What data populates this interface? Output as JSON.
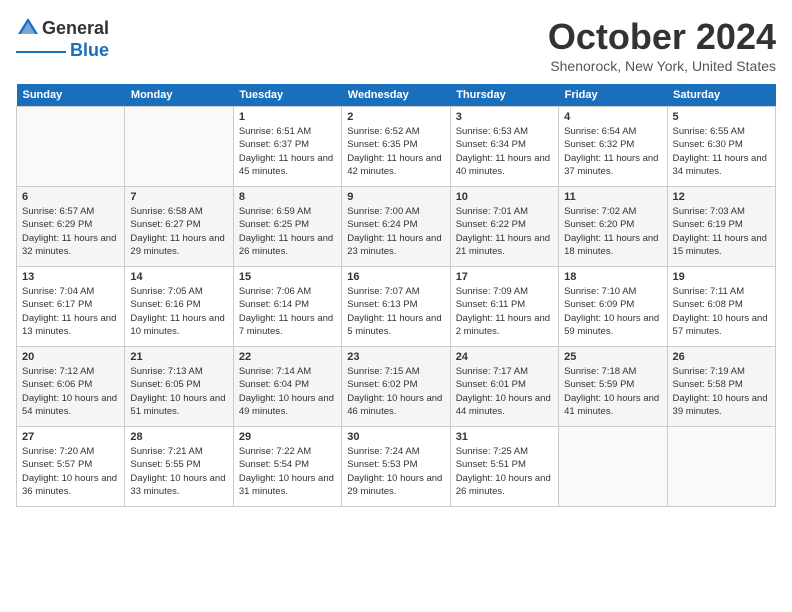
{
  "header": {
    "logo_general": "General",
    "logo_blue": "Blue",
    "month": "October 2024",
    "location": "Shenorock, New York, United States"
  },
  "days_of_week": [
    "Sunday",
    "Monday",
    "Tuesday",
    "Wednesday",
    "Thursday",
    "Friday",
    "Saturday"
  ],
  "weeks": [
    [
      {
        "day": "",
        "info": ""
      },
      {
        "day": "",
        "info": ""
      },
      {
        "day": "1",
        "info": "Sunrise: 6:51 AM\nSunset: 6:37 PM\nDaylight: 11 hours and 45 minutes."
      },
      {
        "day": "2",
        "info": "Sunrise: 6:52 AM\nSunset: 6:35 PM\nDaylight: 11 hours and 42 minutes."
      },
      {
        "day": "3",
        "info": "Sunrise: 6:53 AM\nSunset: 6:34 PM\nDaylight: 11 hours and 40 minutes."
      },
      {
        "day": "4",
        "info": "Sunrise: 6:54 AM\nSunset: 6:32 PM\nDaylight: 11 hours and 37 minutes."
      },
      {
        "day": "5",
        "info": "Sunrise: 6:55 AM\nSunset: 6:30 PM\nDaylight: 11 hours and 34 minutes."
      }
    ],
    [
      {
        "day": "6",
        "info": "Sunrise: 6:57 AM\nSunset: 6:29 PM\nDaylight: 11 hours and 32 minutes."
      },
      {
        "day": "7",
        "info": "Sunrise: 6:58 AM\nSunset: 6:27 PM\nDaylight: 11 hours and 29 minutes."
      },
      {
        "day": "8",
        "info": "Sunrise: 6:59 AM\nSunset: 6:25 PM\nDaylight: 11 hours and 26 minutes."
      },
      {
        "day": "9",
        "info": "Sunrise: 7:00 AM\nSunset: 6:24 PM\nDaylight: 11 hours and 23 minutes."
      },
      {
        "day": "10",
        "info": "Sunrise: 7:01 AM\nSunset: 6:22 PM\nDaylight: 11 hours and 21 minutes."
      },
      {
        "day": "11",
        "info": "Sunrise: 7:02 AM\nSunset: 6:20 PM\nDaylight: 11 hours and 18 minutes."
      },
      {
        "day": "12",
        "info": "Sunrise: 7:03 AM\nSunset: 6:19 PM\nDaylight: 11 hours and 15 minutes."
      }
    ],
    [
      {
        "day": "13",
        "info": "Sunrise: 7:04 AM\nSunset: 6:17 PM\nDaylight: 11 hours and 13 minutes."
      },
      {
        "day": "14",
        "info": "Sunrise: 7:05 AM\nSunset: 6:16 PM\nDaylight: 11 hours and 10 minutes."
      },
      {
        "day": "15",
        "info": "Sunrise: 7:06 AM\nSunset: 6:14 PM\nDaylight: 11 hours and 7 minutes."
      },
      {
        "day": "16",
        "info": "Sunrise: 7:07 AM\nSunset: 6:13 PM\nDaylight: 11 hours and 5 minutes."
      },
      {
        "day": "17",
        "info": "Sunrise: 7:09 AM\nSunset: 6:11 PM\nDaylight: 11 hours and 2 minutes."
      },
      {
        "day": "18",
        "info": "Sunrise: 7:10 AM\nSunset: 6:09 PM\nDaylight: 10 hours and 59 minutes."
      },
      {
        "day": "19",
        "info": "Sunrise: 7:11 AM\nSunset: 6:08 PM\nDaylight: 10 hours and 57 minutes."
      }
    ],
    [
      {
        "day": "20",
        "info": "Sunrise: 7:12 AM\nSunset: 6:06 PM\nDaylight: 10 hours and 54 minutes."
      },
      {
        "day": "21",
        "info": "Sunrise: 7:13 AM\nSunset: 6:05 PM\nDaylight: 10 hours and 51 minutes."
      },
      {
        "day": "22",
        "info": "Sunrise: 7:14 AM\nSunset: 6:04 PM\nDaylight: 10 hours and 49 minutes."
      },
      {
        "day": "23",
        "info": "Sunrise: 7:15 AM\nSunset: 6:02 PM\nDaylight: 10 hours and 46 minutes."
      },
      {
        "day": "24",
        "info": "Sunrise: 7:17 AM\nSunset: 6:01 PM\nDaylight: 10 hours and 44 minutes."
      },
      {
        "day": "25",
        "info": "Sunrise: 7:18 AM\nSunset: 5:59 PM\nDaylight: 10 hours and 41 minutes."
      },
      {
        "day": "26",
        "info": "Sunrise: 7:19 AM\nSunset: 5:58 PM\nDaylight: 10 hours and 39 minutes."
      }
    ],
    [
      {
        "day": "27",
        "info": "Sunrise: 7:20 AM\nSunset: 5:57 PM\nDaylight: 10 hours and 36 minutes."
      },
      {
        "day": "28",
        "info": "Sunrise: 7:21 AM\nSunset: 5:55 PM\nDaylight: 10 hours and 33 minutes."
      },
      {
        "day": "29",
        "info": "Sunrise: 7:22 AM\nSunset: 5:54 PM\nDaylight: 10 hours and 31 minutes."
      },
      {
        "day": "30",
        "info": "Sunrise: 7:24 AM\nSunset: 5:53 PM\nDaylight: 10 hours and 29 minutes."
      },
      {
        "day": "31",
        "info": "Sunrise: 7:25 AM\nSunset: 5:51 PM\nDaylight: 10 hours and 26 minutes."
      },
      {
        "day": "",
        "info": ""
      },
      {
        "day": "",
        "info": ""
      }
    ]
  ]
}
